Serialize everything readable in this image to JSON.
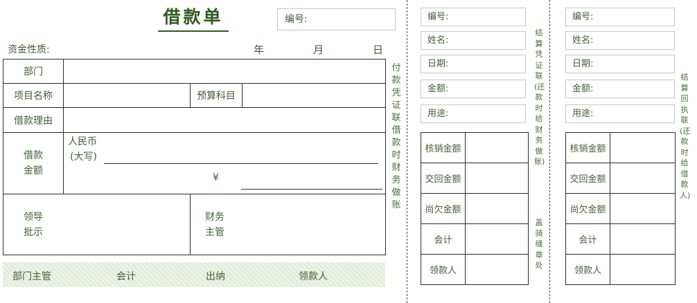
{
  "loan_form": {
    "title": "借款单",
    "serial_label": "编号:",
    "fund_nature_label": "资金性质:",
    "date": {
      "year": "年",
      "month": "月",
      "day": "日"
    },
    "rows": {
      "department": "部门",
      "project_name": "项目名称",
      "budget_subject": "预算科目",
      "reason": "借款理由",
      "amount_label_1": "借款",
      "amount_label_2": "金额",
      "rmb_label": "人民币",
      "capital_label": "(大写)",
      "yen_symbol": "¥",
      "leader_1": "领导",
      "leader_2": "批示",
      "finance_1": "财务",
      "finance_2": "主管"
    },
    "footer": {
      "dept_head": "部门主管",
      "accountant": "会计",
      "cashier": "出纳",
      "receiver": "领款人"
    },
    "side_label": "付款凭证联借款时财务做账"
  },
  "stub1": {
    "fields": [
      "编号:",
      "姓名:",
      "日期:",
      "金额:",
      "用途:"
    ],
    "table_rows": [
      "核销金额",
      "交回金额",
      "尚欠金额",
      "会计",
      "领款人"
    ],
    "side_label": "结算凭证联(还款时给财务做账)",
    "seal_label": "盖骑缝章处"
  },
  "stub2": {
    "fields": [
      "编号:",
      "姓名:",
      "日期:",
      "金额:",
      "用途:"
    ],
    "table_rows": [
      "核销金额",
      "交回金额",
      "尚欠金额",
      "会计",
      "领款人"
    ],
    "side_label": "结算回执联(还款时给借款人)"
  }
}
